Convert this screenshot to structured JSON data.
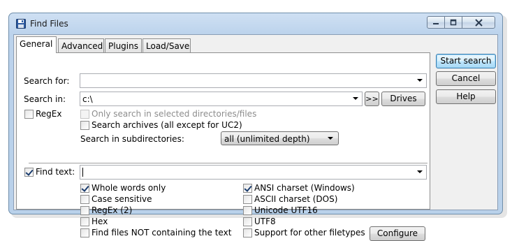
{
  "window": {
    "title": "Find Files"
  },
  "tabs": [
    {
      "label": "General"
    },
    {
      "label": "Advanced"
    },
    {
      "label": "Plugins"
    },
    {
      "label": "Load/Save"
    }
  ],
  "general": {
    "search_for": {
      "label": "Search for:",
      "value": ""
    },
    "search_in": {
      "label": "Search in:",
      "value": "c:\\"
    },
    "browse_label": ">>",
    "drives_label": "Drives",
    "regex": {
      "label": "RegEx",
      "checked": false
    },
    "only_selected": {
      "label": "Only search in selected directories/files",
      "checked": false,
      "disabled": true
    },
    "search_archives": {
      "label": "Search archives (all except for UC2)",
      "checked": false
    },
    "subdirs": {
      "label": "Search in subdirectories:",
      "value": "all (unlimited depth)"
    },
    "find_text": {
      "label": "Find text:",
      "checked": true,
      "value": ""
    },
    "options_left": [
      {
        "label": "Whole words only",
        "checked": true
      },
      {
        "label": "Case sensitive",
        "checked": false
      },
      {
        "label": "RegEx (2)",
        "checked": false
      },
      {
        "label": "Hex",
        "checked": false
      },
      {
        "label": "Find files NOT containing the text",
        "checked": false
      }
    ],
    "options_right": [
      {
        "label": "ANSI charset (Windows)",
        "checked": true
      },
      {
        "label": "ASCII charset (DOS)",
        "checked": false
      },
      {
        "label": "Unicode UTF16",
        "checked": false
      },
      {
        "label": "UTF8",
        "checked": false
      },
      {
        "label": "Support for other filetypes",
        "checked": false
      }
    ],
    "configure_label": "Configure"
  },
  "side_buttons": {
    "start": "Start search",
    "cancel": "Cancel",
    "help": "Help"
  },
  "colors": {
    "title_bar": "#bcd3ec",
    "default_button": "#bee6fd"
  }
}
